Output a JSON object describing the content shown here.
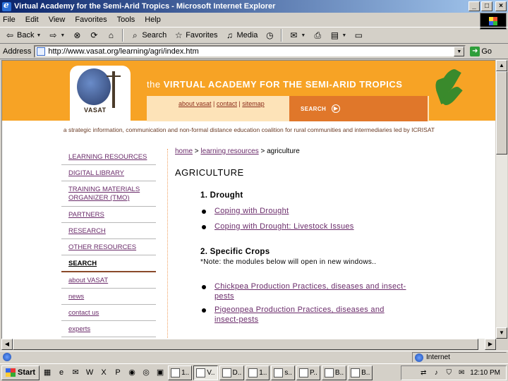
{
  "window": {
    "title": "Virtual Academy for the Semi-Arid Tropics - Microsoft Internet Explorer",
    "min": "_",
    "max": "□",
    "close": "×"
  },
  "menu": [
    "File",
    "Edit",
    "View",
    "Favorites",
    "Tools",
    "Help"
  ],
  "toolbar": {
    "back": "Back",
    "search": "Search",
    "favorites": "Favorites",
    "media": "Media"
  },
  "address": {
    "label": "Address",
    "url": "http://www.vasat.org/learning/agri/index.htm",
    "go": "Go"
  },
  "banner": {
    "logo_text": "VASAT",
    "title_prefix": "the",
    "title": "VIRTUAL ACADEMY FOR THE SEMI-ARID TROPICS",
    "links": [
      "about vasat",
      "contact",
      "sitemap"
    ],
    "search": "SEARCH",
    "tagline": "a strategic information, communication and non-formal distance education coalition for rural communities and intermediaries led by ICRISAT"
  },
  "leftnav": [
    {
      "label": "LEARNING RESOURCES",
      "active": false
    },
    {
      "label": "DIGITAL LIBRARY",
      "active": false
    },
    {
      "label": "TRAINING MATERIALS ORGANIZER (TMO)",
      "active": false
    },
    {
      "label": "PARTNERS",
      "active": false
    },
    {
      "label": "RESEARCH",
      "active": false
    },
    {
      "label": "OTHER RESOURCES",
      "active": false
    },
    {
      "label": "SEARCH",
      "active": true
    },
    {
      "label": "about VASAT",
      "active": false
    },
    {
      "label": "news",
      "active": false
    },
    {
      "label": "contact us",
      "active": false
    },
    {
      "label": "experts",
      "active": false
    }
  ],
  "breadcrumb": {
    "home": "home",
    "sep": ">",
    "resources": "learning resources",
    "current": "agriculture"
  },
  "page": {
    "title": "AGRICULTURE",
    "section1": "1. Drought",
    "section1_links": [
      "Coping with Drought",
      "Coping with Drought: Livestock Issues"
    ],
    "section2": "2. Specific Crops",
    "note": "*Note: the modules below will open in new windows..",
    "section2_links": [
      "Chickpea Production Practices, diseases and insect-pests",
      "Pigeonpea Production Practices, diseases and insect-pests"
    ]
  },
  "statusbar": {
    "zone": "Internet"
  },
  "taskbar": {
    "start": "Start",
    "tasks": [
      "1..",
      "V..",
      "D..",
      "1..",
      "s..",
      "P..",
      "B..",
      "B.."
    ],
    "clock": "12:10 PM"
  }
}
